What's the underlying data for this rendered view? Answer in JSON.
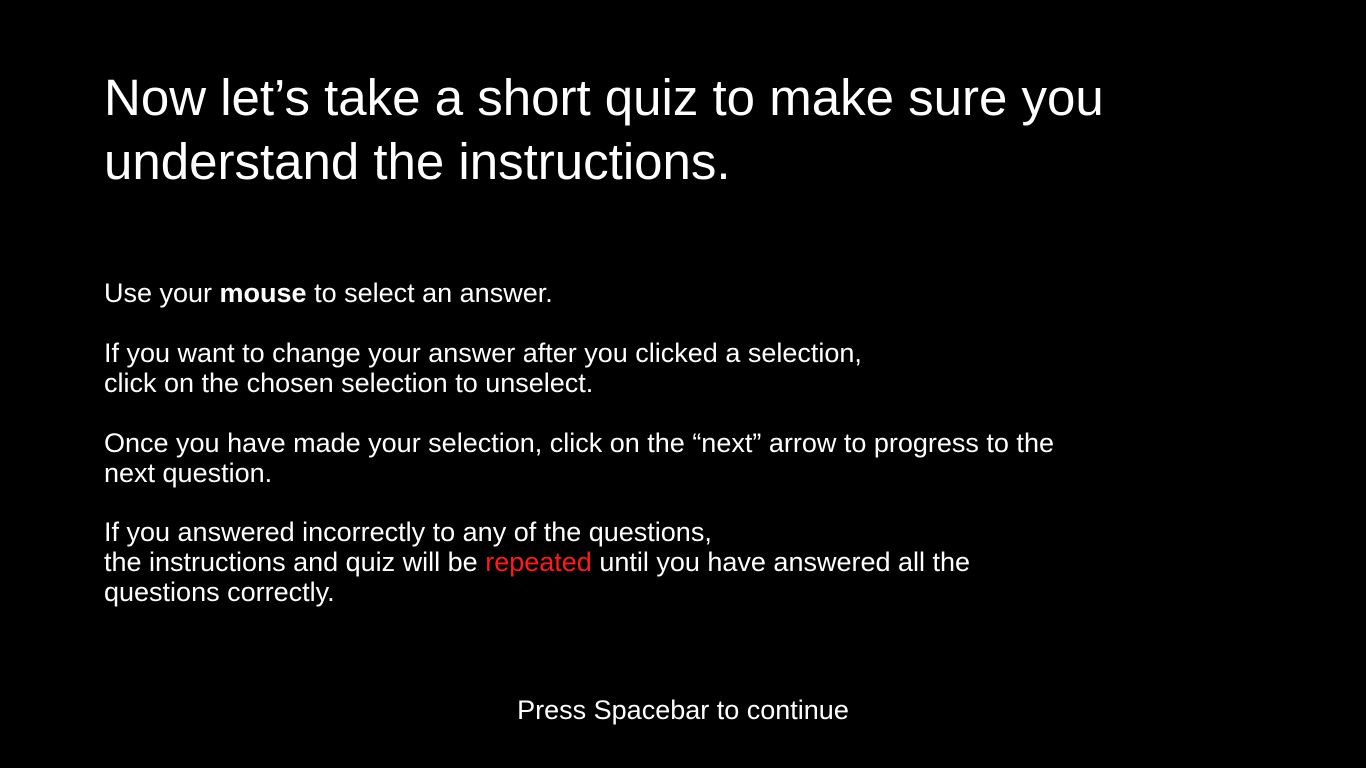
{
  "heading": {
    "line1": "Now let’s take a short quiz to make sure you",
    "line2": "understand the instructions."
  },
  "instructions": {
    "p1": {
      "pre": "Use your ",
      "bold": "mouse",
      "post": " to select an answer."
    },
    "p2": {
      "line1": "If you want to change your answer after you clicked a selection,",
      "line2": "click on the chosen selection to unselect."
    },
    "p3": {
      "line1": "Once you have made your selection, click  on the “next” arrow to progress to the",
      "line2": "next question."
    },
    "p4": {
      "line1": "If you answered incorrectly to any of the questions,",
      "line2_pre": "the instructions and quiz will be ",
      "line2_highlight": "repeated",
      "line2_post": " until you have answered all the",
      "line3": "questions correctly."
    }
  },
  "footer": {
    "text": "Press Spacebar to continue"
  },
  "colors": {
    "background": "#000000",
    "text": "#ffffff",
    "highlight": "#ff1a1a"
  }
}
